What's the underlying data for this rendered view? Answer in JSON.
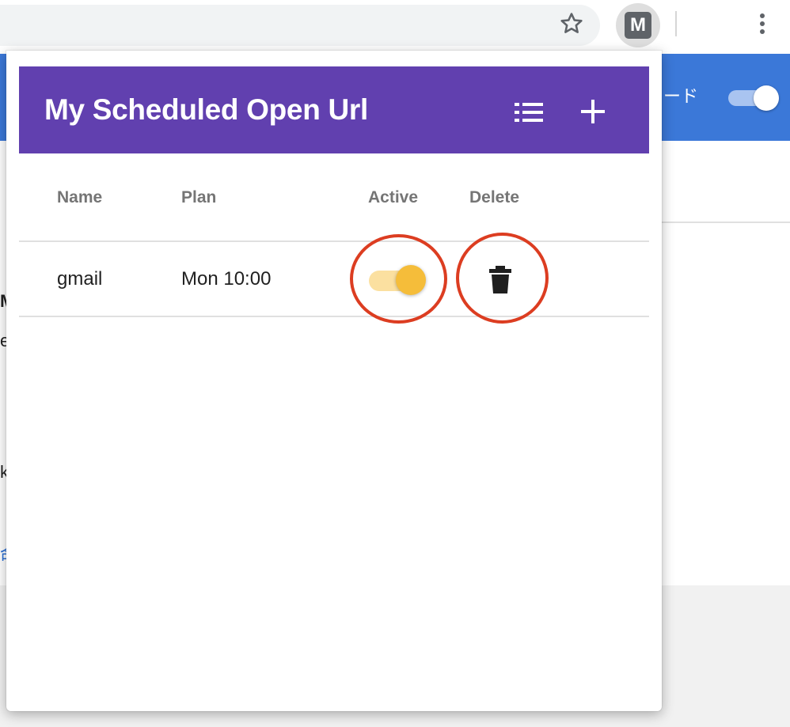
{
  "browser": {
    "bookmark_icon": "star-outline-icon",
    "extension": {
      "icon": "extension-m-icon",
      "letter": "M"
    },
    "menu_icon": "more-vertical-icon"
  },
  "background_page": {
    "banner_text": "ード",
    "banner_color": "#3b78d8",
    "fragments": [
      "M",
      "e",
      "k",
      "命"
    ]
  },
  "popup": {
    "title": "My Scheduled Open Url",
    "header_color": "#6140af",
    "actions": {
      "list_icon": "list-icon",
      "add_icon": "add-icon"
    },
    "columns": [
      "Name",
      "Plan",
      "Active",
      "Delete"
    ],
    "rows": [
      {
        "name": "gmail",
        "plan": "Mon 10:00",
        "active": true,
        "delete_icon": "trash-icon"
      }
    ],
    "toggle_color": "#f5bd3a",
    "annotation_color": "#dc3d21"
  }
}
